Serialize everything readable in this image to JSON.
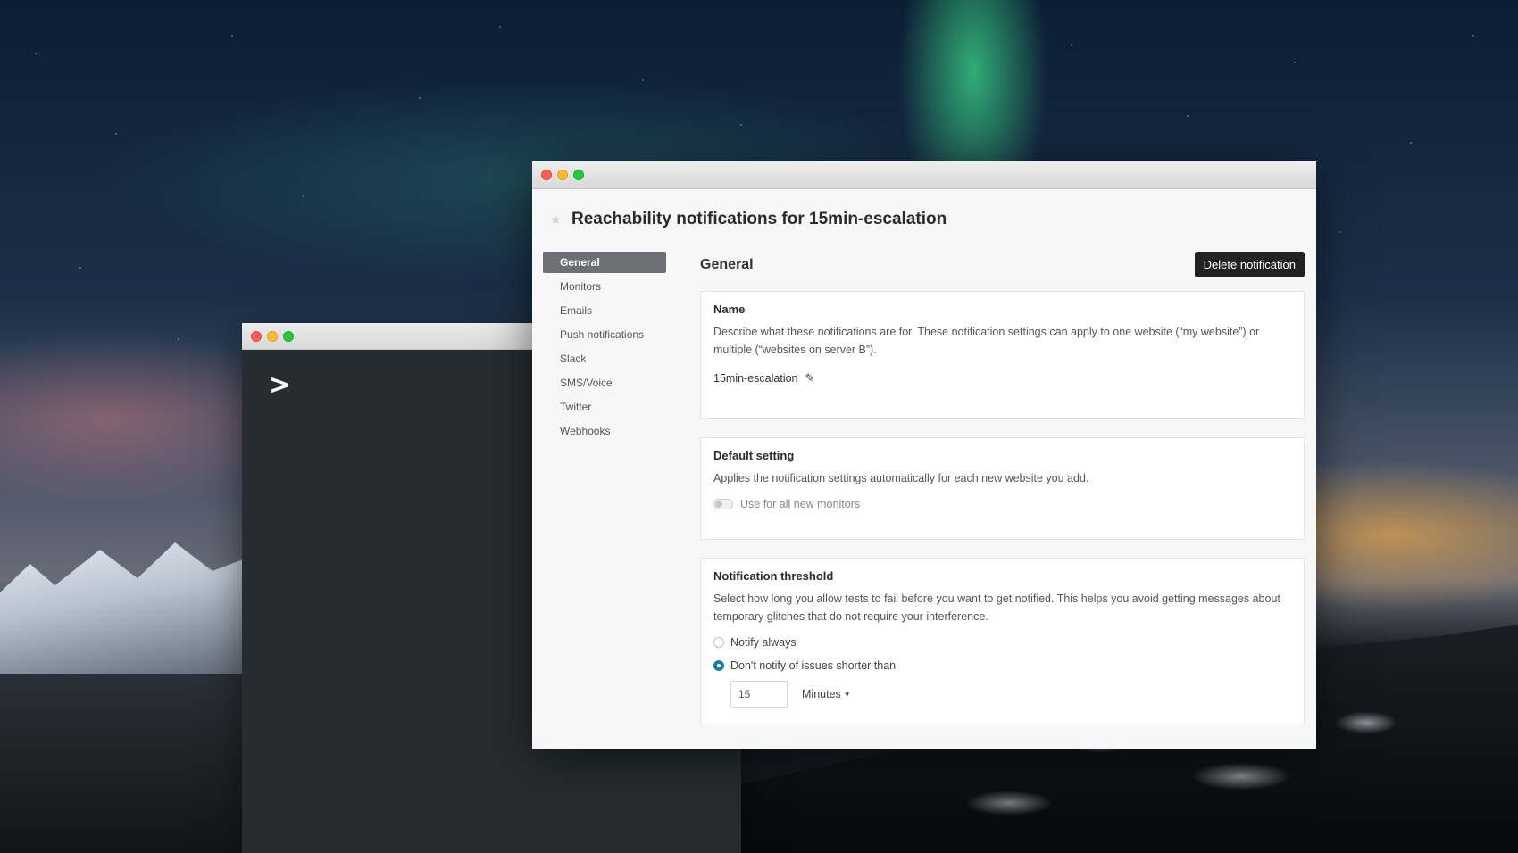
{
  "terminal": {
    "prompt": ">"
  },
  "window": {
    "title": "Reachability notifications for 15min-escalation"
  },
  "sidebar": {
    "items": [
      {
        "label": "General"
      },
      {
        "label": "Monitors"
      },
      {
        "label": "Emails"
      },
      {
        "label": "Push notifications"
      },
      {
        "label": "Slack"
      },
      {
        "label": "SMS/Voice"
      },
      {
        "label": "Twitter"
      },
      {
        "label": "Webhooks"
      }
    ],
    "active": "General"
  },
  "content": {
    "section_title": "General",
    "delete_label": "Delete notification",
    "name_card": {
      "title": "Name",
      "description": "Describe what these notifications are for. These notification settings can apply to one website (“my website”) or multiple (“websites on server B”).",
      "value": "15min-escalation"
    },
    "default_card": {
      "title": "Default setting",
      "description": "Applies the notification settings automatically for each new website you add.",
      "toggle_label": "Use for all new monitors",
      "toggle_on": false
    },
    "threshold_card": {
      "title": "Notification threshold",
      "description": "Select how long you allow tests to fail before you want to get notified. This helps you avoid getting messages about temporary glitches that do not require your interference.",
      "option_always": "Notify always",
      "option_shorter": "Don't notify of issues shorter than",
      "selected": "option_shorter",
      "value": "15",
      "unit": "Minutes"
    }
  },
  "colors": {
    "active_nav": "#6c6f73",
    "delete_button": "#222222",
    "radio_checked": "#1a7fa6"
  },
  "icons": {
    "star": "star-icon",
    "pencil": "pencil-icon",
    "caret": "caret-down-icon"
  }
}
